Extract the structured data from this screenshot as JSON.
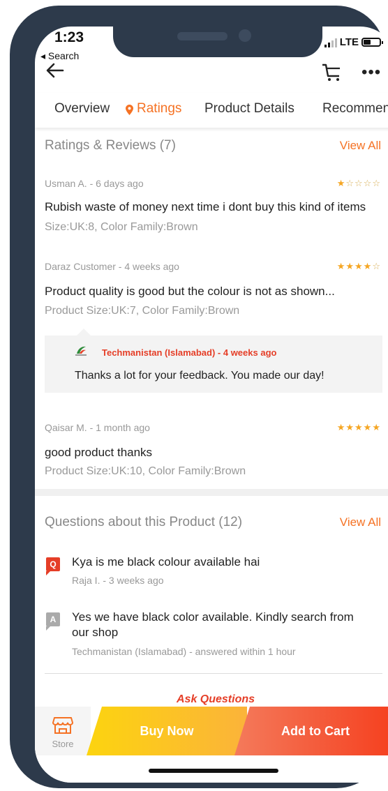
{
  "status": {
    "time": "1:23",
    "back_label": "◂ Search",
    "network": "LTE"
  },
  "tabs": [
    {
      "label": "Overview"
    },
    {
      "label": "Ratings"
    },
    {
      "label": "Product Details"
    },
    {
      "label": "Recommended"
    }
  ],
  "ratings": {
    "title": "Ratings & Reviews (7)",
    "view_all": "View All",
    "reviews": [
      {
        "meta": "Usman A. - 6 days ago",
        "stars": 1,
        "text": "Rubish waste of money next time i dont buy this kind of items",
        "sku": "Size:UK:8, Color Family:Brown"
      },
      {
        "meta": "Daraz Customer - 4 weeks ago",
        "stars": 4,
        "text": "Product quality is good but the colour is not as shown...",
        "sku": "Product Size:UK:7, Color Family:Brown",
        "reply": {
          "seller": "Techmanistan (Islamabad) - 4 weeks ago",
          "text": "Thanks a lot for your feedback. You made our day!"
        }
      },
      {
        "meta": "Qaisar M. - 1 month ago",
        "stars": 5,
        "text": "good product thanks",
        "sku": "Product Size:UK:10, Color Family:Brown"
      }
    ]
  },
  "questions": {
    "title": "Questions about this Product (12)",
    "view_all": "View All",
    "q_badge": "Q",
    "a_badge": "A",
    "question": "Kya is me black colour available hai",
    "question_meta": "Raja I. - 3 weeks ago",
    "answer": "Yes we have black color available. Kindly search from our shop",
    "answer_meta": "Techmanistan (Islamabad) - answered within 1 hour",
    "ask_label": "Ask Questions"
  },
  "bottom": {
    "store_label": "Store",
    "buy_now": "Buy Now",
    "add_to_cart": "Add to Cart"
  },
  "colors": {
    "accent": "#f57224",
    "sale_red": "#e53e27",
    "buy_now": "#fcd40f",
    "add_to_cart": "#f53f1e",
    "frame": "#2d3a4b"
  }
}
